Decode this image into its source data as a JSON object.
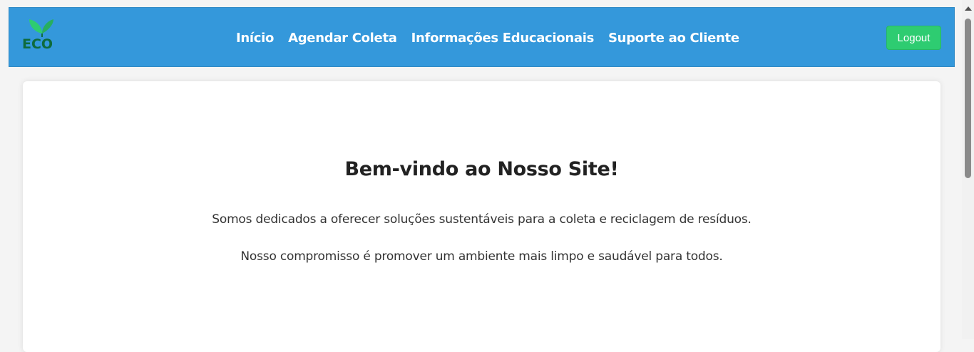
{
  "header": {
    "logo_text": "ECO",
    "logo_icon": "leaf-icon",
    "nav": [
      "Início",
      "Agendar Coleta",
      "Informações Educacionais",
      "Suporte ao Cliente"
    ],
    "logout_label": "Logout"
  },
  "main": {
    "title": "Bem-vindo ao Nosso Site!",
    "paragraphs": [
      "Somos dedicados a oferecer soluções sustentáveis para a coleta e reciclagem de resíduos.",
      "Nosso compromisso é promover um ambiente mais limpo e saudável para todos."
    ]
  },
  "colors": {
    "header_bg": "#3498db",
    "logout_bg": "#2ecc71",
    "logo_green": "#0e6b3c",
    "leaf_green": "#27ae60"
  }
}
